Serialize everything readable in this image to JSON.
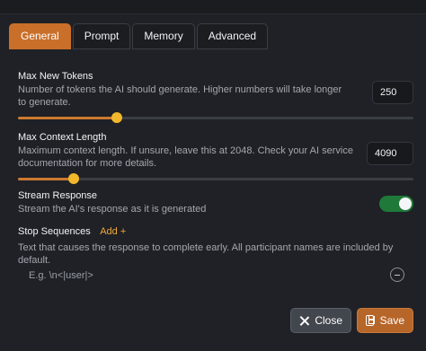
{
  "tabs": [
    {
      "label": "General",
      "active": true
    },
    {
      "label": "Prompt",
      "active": false
    },
    {
      "label": "Memory",
      "active": false
    },
    {
      "label": "Advanced",
      "active": false
    }
  ],
  "max_new_tokens": {
    "label": "Max New Tokens",
    "description": "Number of tokens the AI should generate. Higher numbers will take longer to generate.",
    "value": "250",
    "slider_fraction": 0.25
  },
  "max_context_length": {
    "label": "Max Context Length",
    "description": "Maximum context length. If unsure, leave this at 2048. Check your AI service documentation for more details.",
    "value": "4090",
    "slider_fraction": 0.14
  },
  "stream_response": {
    "label": "Stream Response",
    "description": "Stream the AI's response as it is generated",
    "enabled": true
  },
  "stop_sequences": {
    "label": "Stop Sequences",
    "add_label": "Add +",
    "description": "Text that causes the response to complete early. All participant names are included by default.",
    "placeholder": "E.g. \\n<|user|>"
  },
  "footer": {
    "close_label": "Close",
    "save_label": "Save"
  },
  "colors": {
    "accent": "#c96f2a",
    "slider_thumb": "#f3b72b",
    "toggle_on": "#1f7a3a",
    "add_link": "#f3a93b"
  },
  "icons": {
    "close": "close-icon",
    "save": "save-icon",
    "remove_sequence": "minus-circle-icon"
  }
}
